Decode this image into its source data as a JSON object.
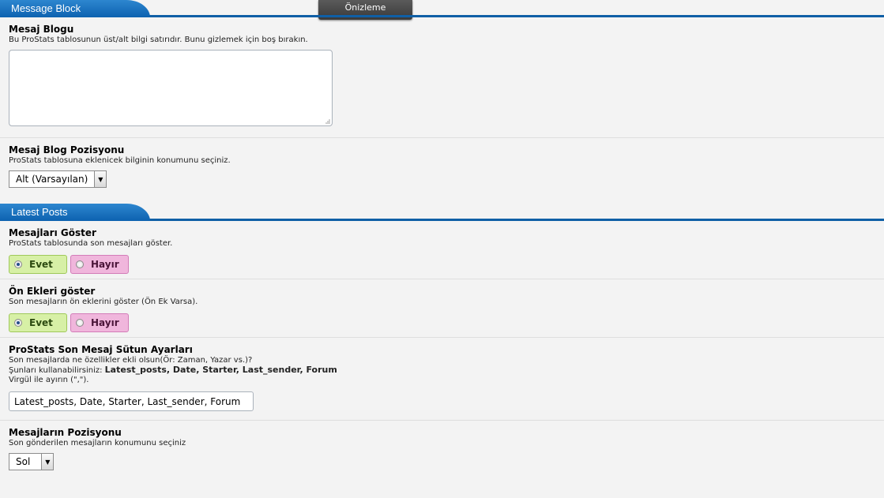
{
  "preview_label": "Önizleme",
  "sections": [
    {
      "header": "Message Block"
    },
    {
      "header": "Latest Posts"
    }
  ],
  "message_blog": {
    "title": "Mesaj Blogu",
    "desc": "Bu ProStats tablosunun üst/alt bilgi satırıdır. Bunu gizlemek için boş bırakın.",
    "value": ""
  },
  "message_position": {
    "title": "Mesaj Blog Pozisyonu",
    "desc": "ProStats tablosuna eklenicek bilginin konumunu seçiniz.",
    "selected": "Alt (Varsayılan)"
  },
  "show_posts": {
    "title": "Mesajları Göster",
    "desc": "ProStats tablosunda son mesajları göster.",
    "yes": "Evet",
    "no": "Hayır",
    "value": "yes"
  },
  "show_prefixes": {
    "title": "Ön Ekleri göster",
    "desc": "Son mesajların ön eklerini göster (Ön Ek Varsa).",
    "yes": "Evet",
    "no": "Hayır",
    "value": "yes"
  },
  "columns": {
    "title": "ProStats Son Mesaj Sütun Ayarları",
    "desc_line1": "Son mesajlarda ne özellikler ekli olsun(Ör: Zaman, Yazar vs.)?",
    "desc_line2_prefix": "Şunları kullanabilirsiniz: ",
    "desc_line2_bold": "Latest_posts, Date, Starter, Last_sender, Forum",
    "desc_line3": "Virgül ile ayırın (\",\").",
    "value": "Latest_posts, Date, Starter, Last_sender, Forum"
  },
  "posts_position": {
    "title": "Mesajların Pozisyonu",
    "desc": "Son gönderilen mesajların konumunu seçiniz",
    "selected": "Sol"
  }
}
